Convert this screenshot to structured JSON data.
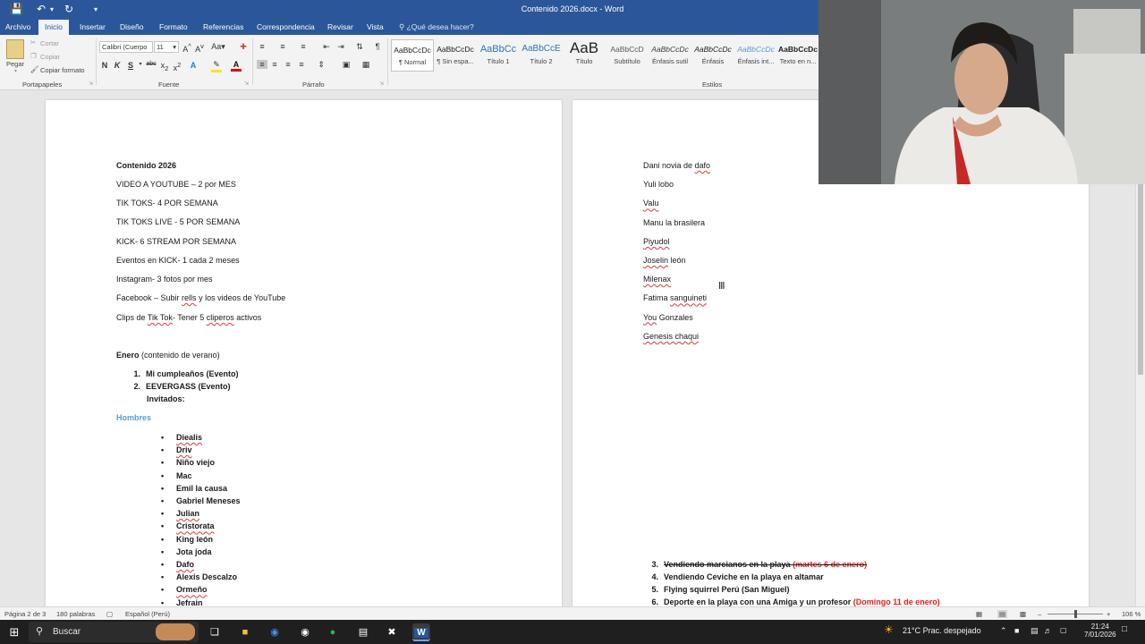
{
  "window": {
    "title": "Contenido 2026.docx - Word"
  },
  "tabs": [
    "Archivo",
    "Inicio",
    "Insertar",
    "Diseño",
    "Formato",
    "Referencias",
    "Correspondencia",
    "Revisar",
    "Vista"
  ],
  "tell_me": "¿Qué desea hacer?",
  "clipboard": {
    "paste": "Pegar",
    "cut": "Cortar",
    "copy": "Copiar",
    "format_painter": "Copiar formato",
    "label": "Portapapeles"
  },
  "font": {
    "name": "Calibri (Cuerpo",
    "size": "11",
    "change_case": "Aa",
    "label": "Fuente"
  },
  "paragraph": {
    "label": "Párrafo"
  },
  "styles": {
    "label": "Estilos",
    "items": [
      {
        "preview": "AaBbCcDc",
        "name": "¶ Normal"
      },
      {
        "preview": "AaBbCcDc",
        "name": "¶ Sin espa..."
      },
      {
        "preview": "AaBbCc",
        "name": "Título 1"
      },
      {
        "preview": "AaBbCcE",
        "name": "Título 2"
      },
      {
        "preview": "AaB",
        "name": "Título"
      },
      {
        "preview": "AaBbCcD",
        "name": "Subtítulo"
      },
      {
        "preview": "AaBbCcDc",
        "name": "Énfasis sutil"
      },
      {
        "preview": "AaBbCcDc",
        "name": "Énfasis"
      },
      {
        "preview": "AaBbCcDc",
        "name": "Énfasis int..."
      },
      {
        "preview": "AaBbCcDc",
        "name": "Texto en n..."
      }
    ]
  },
  "doc": {
    "left": {
      "title": "Contenido 2026",
      "lines": [
        "VIDEO A YOUTUBE – 2 por MES",
        "TIK TOKS- 4 POR SEMANA",
        "TIK TOKS LIVE - 5 POR SEMANA",
        "KICK- 6 STREAM POR SEMANA",
        "Eventos en KICK-  1 cada 2 meses",
        "Instagram- 3 fotos por mes"
      ],
      "facebook": {
        "a": "Facebook – Subir ",
        "b": "rells",
        "c": " y los videos de YouTube"
      },
      "clips": {
        "a": "Clips de ",
        "b": "Tik Tok",
        "c": "- Tener 5 ",
        "d": "cliperos",
        "e": " activos"
      },
      "enero": {
        "bold": "Enero",
        "rest": " (contenido de verano)"
      },
      "events": [
        {
          "num": "1.",
          "text": "Mi cumpleaños (Evento)"
        },
        {
          "num": "2.",
          "text": "EEVERGASS (Evento)"
        }
      ],
      "invitados": "Invitados:",
      "hombres": "Hombres",
      "guests": [
        {
          "name": "Diealis",
          "sq": true
        },
        {
          "name": "Driv",
          "sq": true
        },
        {
          "name": "Niño viejo",
          "sq": false
        },
        {
          "name": "Mac",
          "sq": false
        },
        {
          "name": "Emil la causa",
          "sq": false
        },
        {
          "name": "Gabriel Meneses",
          "sq": false
        },
        {
          "name": "Julian",
          "sq": true
        },
        {
          "name": "Cristorata",
          "sq": true
        },
        {
          "name": "King león",
          "sq": false
        },
        {
          "name": "Jota joda",
          "sq": false
        },
        {
          "name": "Dafo",
          "sq": true
        },
        {
          "name": "Alexis Descalzo",
          "sq": false
        },
        {
          "name": "Ormeño",
          "sq": true
        },
        {
          "name": "Jefrain",
          "sq": false
        }
      ]
    },
    "right": {
      "names": [
        {
          "a": "Dani novia de ",
          "b": "dafo",
          "c": ""
        },
        {
          "a": "Yuli lobo",
          "b": "",
          "c": ""
        },
        {
          "a": "",
          "b": "Valu",
          "c": ""
        },
        {
          "a": "Manu la brasilera",
          "b": "",
          "c": ""
        },
        {
          "a": "",
          "b": "Piyudol",
          "c": ""
        },
        {
          "a": "",
          "b": "Joselin",
          "c": " león"
        },
        {
          "a": "",
          "b": "Milenax",
          "c": ""
        },
        {
          "a": "Fatima ",
          "b": "sanguineti",
          "c": ""
        },
        {
          "a": "",
          "b": "You",
          "c": " Gonzales"
        },
        {
          "a": "",
          "b": "Genesis chaqui",
          "c": ""
        }
      ],
      "numbered": [
        {
          "num": "3.",
          "text": "Vendiendo marcianos en la playa ",
          "red": "(martes 6 de enero)",
          "strike": true
        },
        {
          "num": "4.",
          "text": "Vendiendo Ceviche en la playa en altamar",
          "red": "",
          "strike": false
        },
        {
          "num": "5.",
          "text": "Flying squirrel Perú (San Miguel)",
          "red": "",
          "strike": false
        },
        {
          "num": "6.",
          "text": "Deporte en la playa con una Amiga y un profesor ",
          "red": "(Domingo 11 de enero)",
          "strike": false
        }
      ]
    }
  },
  "status": {
    "page": "Página 2 de 3",
    "words": "180 palabras",
    "language": "Español (Perú)",
    "zoom": "106 %"
  },
  "taskbar": {
    "search": "Buscar",
    "weather": "21°C  Prac. despejado",
    "time": "21:24",
    "date": "7/01/2026"
  },
  "colors": {
    "word_blue": "#2b579a",
    "heading_blue": "#5b9bd5",
    "red": "#e02020"
  }
}
